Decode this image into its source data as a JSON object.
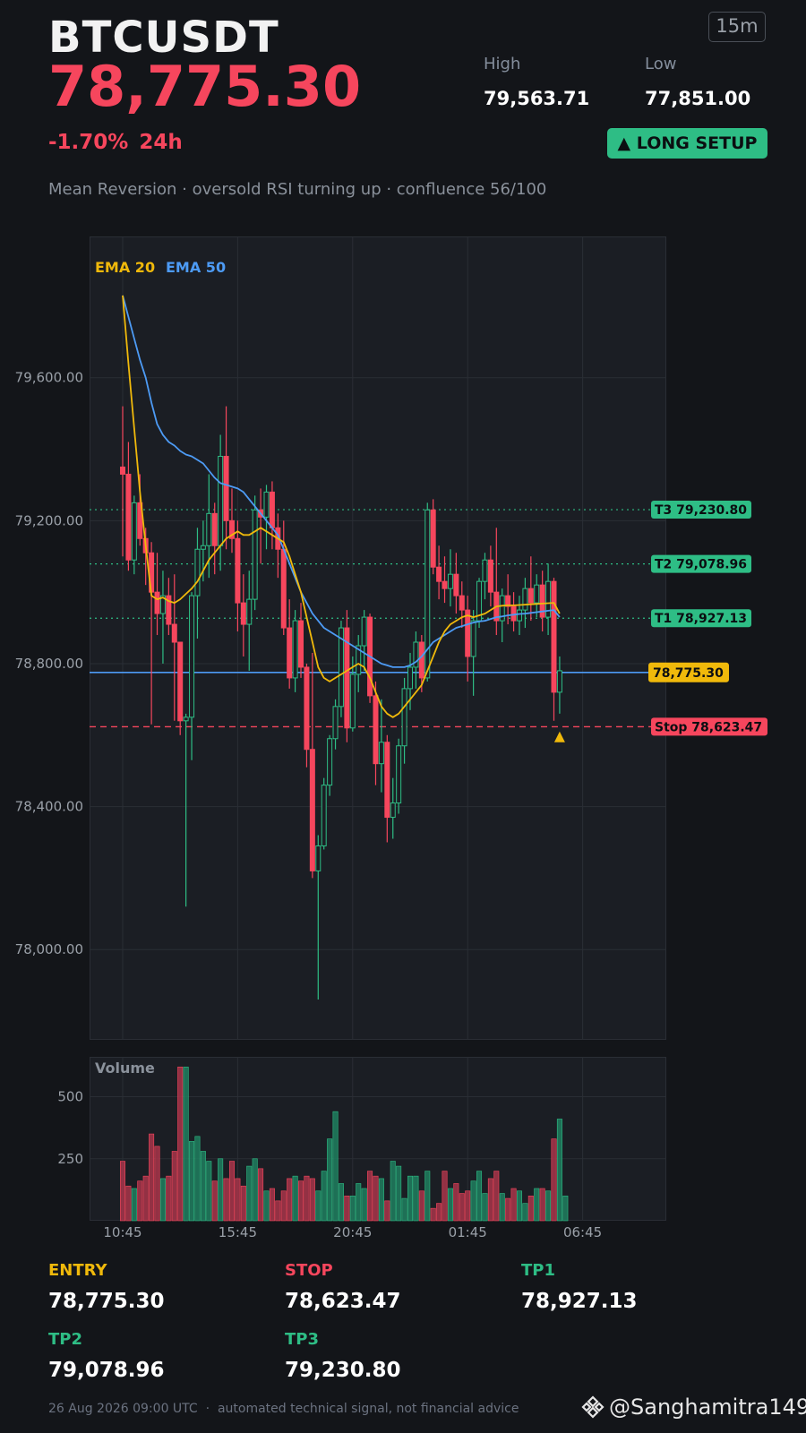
{
  "header": {
    "symbol": "BTCUSDT",
    "price": "78,775.30",
    "change_pct": "-1.70%",
    "change_period": "24h",
    "timeframe": "15m",
    "high_label": "High",
    "high_value": "79,563.71",
    "low_label": "Low",
    "low_value": "77,851.00",
    "setup_badge": "▲ LONG SETUP",
    "subtitle": "Mean Reversion · oversold RSI turning up · confluence 56/100"
  },
  "colors": {
    "up": "#2ebd85",
    "down": "#f6465d",
    "ema20": "#f0b90b",
    "ema50": "#4d9bf5",
    "price_line": "#4d9bf5",
    "background": "#131519",
    "panel": "#1b1e24"
  },
  "levels": [
    {
      "key": "entry",
      "label": "ENTRY",
      "value": "78,775.30",
      "color": "#f0b90b"
    },
    {
      "key": "stop",
      "label": "STOP",
      "value": "78,623.47",
      "color": "#f6465d"
    },
    {
      "key": "tp1",
      "label": "TP1",
      "value": "78,927.13",
      "color": "#2ebd85"
    },
    {
      "key": "tp2",
      "label": "TP2",
      "value": "79,078.96",
      "color": "#2ebd85"
    },
    {
      "key": "tp3",
      "label": "TP3",
      "value": "79,230.80",
      "color": "#2ebd85"
    }
  ],
  "footer": {
    "timestamp": "26 Aug 2026 09:00 UTC",
    "separator": "·",
    "disclaimer": "automated technical signal, not financial advice",
    "brand": "@Sanghamitra149"
  },
  "chart_data": [
    {
      "type": "candlestick",
      "legend": [
        "EMA 20",
        "EMA 50"
      ],
      "ylim": [
        77800,
        79900
      ],
      "yticks": [
        78000,
        78400,
        78800,
        79200,
        79600
      ],
      "ytick_labels": [
        "78,000.00",
        "78,400.00",
        "78,800.00",
        "79,200.00",
        "79,600.00"
      ],
      "xtick_labels": [
        "10:45",
        "15:45",
        "20:45",
        "01:45",
        "06:45"
      ],
      "xtick_index": [
        0,
        20,
        40,
        60,
        80
      ],
      "grid": true,
      "price_line": {
        "value": 78775.3,
        "label": "78,775.30"
      },
      "level_lines": [
        {
          "name": "T3",
          "value": 79230.8,
          "label": "T3 79,230.80"
        },
        {
          "name": "T2",
          "value": 79078.96,
          "label": "T2 79,078.96"
        },
        {
          "name": "T1",
          "value": 78927.13,
          "label": "T1 78,927.13"
        },
        {
          "name": "Stop",
          "value": 78623.47,
          "label": "Stop 78,623.47"
        }
      ],
      "ohlc": [
        [
          79350,
          79520,
          79100,
          79330
        ],
        [
          79330,
          79420,
          79060,
          79090
        ],
        [
          79090,
          79270,
          79050,
          79250
        ],
        [
          79250,
          79330,
          79130,
          79150
        ],
        [
          79150,
          79180,
          79020,
          79110
        ],
        [
          79110,
          79140,
          78630,
          79000
        ],
        [
          79000,
          79110,
          78880,
          78940
        ],
        [
          78940,
          79060,
          78800,
          78990
        ],
        [
          78990,
          79040,
          78880,
          78910
        ],
        [
          78910,
          79050,
          78640,
          78860
        ],
        [
          78860,
          78850,
          78600,
          78640
        ],
        [
          78640,
          78660,
          78120,
          78650
        ],
        [
          78650,
          79000,
          78530,
          78990
        ],
        [
          78990,
          79180,
          78870,
          79120
        ],
        [
          79120,
          79200,
          79030,
          79130
        ],
        [
          79130,
          79330,
          79040,
          79220
        ],
        [
          79220,
          79250,
          79050,
          79130
        ],
        [
          79130,
          79440,
          79060,
          79380
        ],
        [
          79380,
          79520,
          79120,
          79200
        ],
        [
          79200,
          79290,
          79110,
          79150
        ],
        [
          79150,
          79200,
          78890,
          78970
        ],
        [
          78970,
          79050,
          78820,
          78910
        ],
        [
          78910,
          79060,
          78780,
          78980
        ],
        [
          78980,
          79270,
          78950,
          79230
        ],
        [
          79230,
          79290,
          79080,
          79210
        ],
        [
          79210,
          79300,
          79120,
          79280
        ],
        [
          79280,
          79310,
          79120,
          79180
        ],
        [
          79180,
          79220,
          79040,
          79120
        ],
        [
          79120,
          79200,
          78880,
          78900
        ],
        [
          78900,
          78980,
          78730,
          78760
        ],
        [
          78760,
          78950,
          78720,
          78920
        ],
        [
          78920,
          78970,
          78760,
          78790
        ],
        [
          78790,
          78800,
          78510,
          78560
        ],
        [
          78560,
          78830,
          78200,
          78220
        ],
        [
          78220,
          78320,
          77860,
          78290
        ],
        [
          78290,
          78480,
          78280,
          78460
        ],
        [
          78460,
          78600,
          78430,
          78590
        ],
        [
          78590,
          78700,
          78560,
          78680
        ],
        [
          78680,
          78920,
          78650,
          78900
        ],
        [
          78900,
          78950,
          78580,
          78620
        ],
        [
          78620,
          78820,
          78610,
          78770
        ],
        [
          78770,
          78880,
          78720,
          78850
        ],
        [
          78850,
          78950,
          78780,
          78930
        ],
        [
          78930,
          78940,
          78690,
          78710
        ],
        [
          78710,
          78750,
          78460,
          78520
        ],
        [
          78520,
          78700,
          78440,
          78580
        ],
        [
          78580,
          78600,
          78300,
          78370
        ],
        [
          78370,
          78480,
          78310,
          78410
        ],
        [
          78410,
          78590,
          78380,
          78570
        ],
        [
          78570,
          78760,
          78520,
          78730
        ],
        [
          78730,
          78830,
          78670,
          78790
        ],
        [
          78790,
          78890,
          78730,
          78860
        ],
        [
          78860,
          78880,
          78720,
          78760
        ],
        [
          78760,
          79250,
          78750,
          79230
        ],
        [
          79230,
          79260,
          79050,
          79070
        ],
        [
          79070,
          79130,
          78980,
          79030
        ],
        [
          79030,
          79100,
          78970,
          79010
        ],
        [
          79010,
          79120,
          78960,
          79050
        ],
        [
          79050,
          79110,
          78940,
          78990
        ],
        [
          78990,
          79030,
          78900,
          78950
        ],
        [
          78950,
          78990,
          78750,
          78820
        ],
        [
          78820,
          78950,
          78710,
          78920
        ],
        [
          78920,
          79040,
          78900,
          79030
        ],
        [
          79030,
          79110,
          78980,
          79090
        ],
        [
          79090,
          79130,
          78960,
          79000
        ],
        [
          79000,
          79180,
          78880,
          78920
        ],
        [
          78920,
          79010,
          78860,
          78990
        ],
        [
          78990,
          79050,
          78910,
          78960
        ],
        [
          78960,
          79000,
          78890,
          78920
        ],
        [
          78920,
          78990,
          78880,
          78950
        ],
        [
          78950,
          79040,
          78900,
          79010
        ],
        [
          79010,
          79100,
          78920,
          78970
        ],
        [
          78970,
          79050,
          78930,
          79020
        ],
        [
          79020,
          79060,
          78890,
          78930
        ],
        [
          78930,
          79080,
          78880,
          79030
        ],
        [
          79030,
          79040,
          78640,
          78720
        ],
        [
          78720,
          78820,
          78660,
          78780
        ]
      ],
      "ema20": [
        79830,
        79640,
        79460,
        79280,
        79130,
        78990,
        78980,
        78985,
        78975,
        78970,
        78980,
        78995,
        79010,
        79030,
        79060,
        79090,
        79110,
        79130,
        79150,
        79160,
        79170,
        79160,
        79160,
        79170,
        79180,
        79170,
        79160,
        79150,
        79140,
        79100,
        79050,
        79000,
        78930,
        78860,
        78790,
        78760,
        78750,
        78760,
        78770,
        78780,
        78790,
        78800,
        78790,
        78760,
        78720,
        78680,
        78660,
        78650,
        78660,
        78680,
        78700,
        78720,
        78740,
        78780,
        78820,
        78860,
        78890,
        78910,
        78920,
        78930,
        78935,
        78930,
        78935,
        78940,
        78950,
        78960,
        78962,
        78963,
        78963,
        78964,
        78965,
        78966,
        78967,
        78968,
        78969,
        78970,
        78940
      ],
      "ema50": [
        79830,
        79770,
        79710,
        79650,
        79600,
        79530,
        79470,
        79440,
        79420,
        79410,
        79395,
        79385,
        79380,
        79370,
        79360,
        79340,
        79320,
        79305,
        79300,
        79295,
        79290,
        79280,
        79260,
        79240,
        79220,
        79200,
        79180,
        79160,
        79120,
        79080,
        79040,
        79000,
        78970,
        78940,
        78920,
        78900,
        78890,
        78880,
        78870,
        78860,
        78850,
        78840,
        78830,
        78820,
        78810,
        78800,
        78795,
        78790,
        78790,
        78790,
        78795,
        78805,
        78820,
        78840,
        78860,
        78870,
        78880,
        78890,
        78900,
        78905,
        78910,
        78915,
        78918,
        78920,
        78925,
        78930,
        78932,
        78935,
        78937,
        78939,
        78940,
        78942,
        78944,
        78946,
        78948,
        78950,
        78930
      ],
      "buy_marker": {
        "index": 76,
        "value": 78600
      }
    },
    {
      "type": "bar",
      "title": "Volume",
      "ylim": [
        0,
        650
      ],
      "yticks": [
        250,
        500
      ],
      "ytick_labels": [
        "250",
        "500"
      ],
      "values": [
        240,
        140,
        130,
        160,
        180,
        350,
        300,
        170,
        180,
        280,
        620,
        620,
        320,
        340,
        280,
        240,
        160,
        250,
        170,
        240,
        170,
        140,
        220,
        250,
        210,
        120,
        130,
        80,
        120,
        170,
        180,
        160,
        180,
        170,
        120,
        200,
        330,
        440,
        150,
        100,
        100,
        150,
        130,
        200,
        180,
        170,
        80,
        240,
        220,
        90,
        180,
        180,
        120,
        200,
        50,
        70,
        200,
        130,
        150,
        110,
        120,
        160,
        200,
        110,
        170,
        200,
        110,
        90,
        130,
        120,
        70,
        100,
        130,
        130,
        120,
        330,
        410,
        100
      ]
    }
  ]
}
